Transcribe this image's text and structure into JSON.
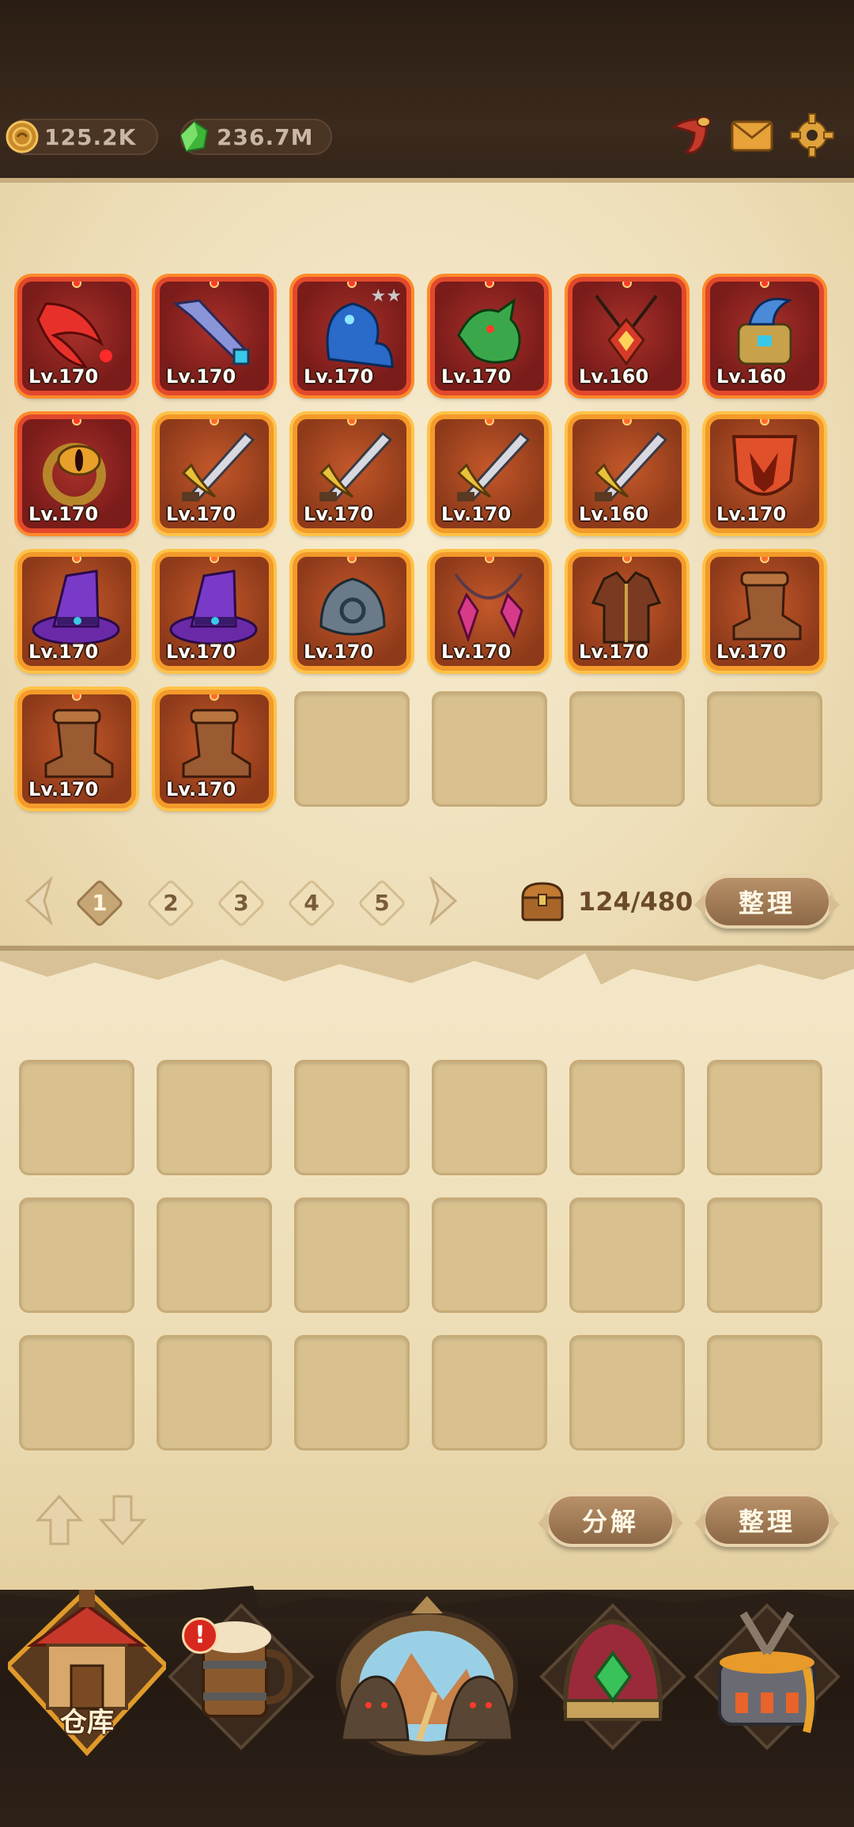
{
  "currencies": {
    "gold": {
      "icon": "gold-coin-icon",
      "value": "125.2K"
    },
    "gems": {
      "icon": "green-gem-icon",
      "value": "236.7M"
    }
  },
  "top_icons": [
    "horn-icon",
    "mail-icon",
    "settings-gear-icon"
  ],
  "inventory": {
    "items": [
      {
        "icon": "red-blade-icon",
        "level": "Lv.170",
        "rarity": "red",
        "stars": ""
      },
      {
        "icon": "crystal-sword-icon",
        "level": "Lv.170",
        "rarity": "red",
        "stars": ""
      },
      {
        "icon": "blue-spirit-icon",
        "level": "Lv.170",
        "rarity": "red",
        "stars": "★★"
      },
      {
        "icon": "dragon-head-icon",
        "level": "Lv.170",
        "rarity": "red",
        "stars": ""
      },
      {
        "icon": "red-amulet-icon",
        "level": "Lv.160",
        "rarity": "red",
        "stars": ""
      },
      {
        "icon": "feathered-gauntlet-icon",
        "level": "Lv.160",
        "rarity": "red",
        "stars": ""
      },
      {
        "icon": "eye-ring-icon",
        "level": "Lv.170",
        "rarity": "red",
        "stars": ""
      },
      {
        "icon": "sword-icon",
        "level": "Lv.170",
        "rarity": "orange",
        "stars": ""
      },
      {
        "icon": "sword-icon",
        "level": "Lv.170",
        "rarity": "orange",
        "stars": ""
      },
      {
        "icon": "sword-icon",
        "level": "Lv.170",
        "rarity": "orange",
        "stars": ""
      },
      {
        "icon": "sword-icon",
        "level": "Lv.160",
        "rarity": "orange",
        "stars": ""
      },
      {
        "icon": "wolf-shield-icon",
        "level": "Lv.170",
        "rarity": "orange",
        "stars": ""
      },
      {
        "icon": "wizard-hat-icon",
        "level": "Lv.170",
        "rarity": "orange",
        "stars": ""
      },
      {
        "icon": "wizard-hat-icon",
        "level": "Lv.170",
        "rarity": "orange",
        "stars": ""
      },
      {
        "icon": "stone-gauntlet-icon",
        "level": "Lv.170",
        "rarity": "orange",
        "stars": ""
      },
      {
        "icon": "pink-crystal-necklace-icon",
        "level": "Lv.170",
        "rarity": "orange",
        "stars": ""
      },
      {
        "icon": "leather-armor-icon",
        "level": "Lv.170",
        "rarity": "orange",
        "stars": ""
      },
      {
        "icon": "leather-boot-icon",
        "level": "Lv.170",
        "rarity": "orange",
        "stars": ""
      },
      {
        "icon": "leather-boot-icon",
        "level": "Lv.170",
        "rarity": "orange",
        "stars": ""
      },
      {
        "icon": "leather-boot-icon",
        "level": "Lv.170",
        "rarity": "orange",
        "stars": ""
      }
    ],
    "empty_slots": 4,
    "pagination": {
      "pages": [
        "1",
        "2",
        "3",
        "4",
        "5"
      ],
      "active": "1"
    },
    "capacity": "124/480",
    "sort_label": "整理"
  },
  "warehouse": {
    "empty_slots": 18,
    "decompose_label": "分解",
    "sort_label": "整理"
  },
  "nav": {
    "items": [
      {
        "name": "warehouse",
        "label": "仓库",
        "icon": "warehouse-house-icon",
        "active": true
      },
      {
        "name": "tavern",
        "label": "",
        "icon": "beer-mug-icon",
        "alert": "!"
      },
      {
        "name": "adventure",
        "label": "",
        "icon": "portal-icon"
      },
      {
        "name": "treasure",
        "label": "",
        "icon": "treasure-helmet-icon"
      },
      {
        "name": "forge",
        "label": "",
        "icon": "forge-cauldron-icon"
      }
    ]
  },
  "colors": {
    "red_frame": "#e2482c",
    "orange_frame": "#f39a2a",
    "parchment": "#efe0bc",
    "empty_slot": "#d8c18f"
  }
}
